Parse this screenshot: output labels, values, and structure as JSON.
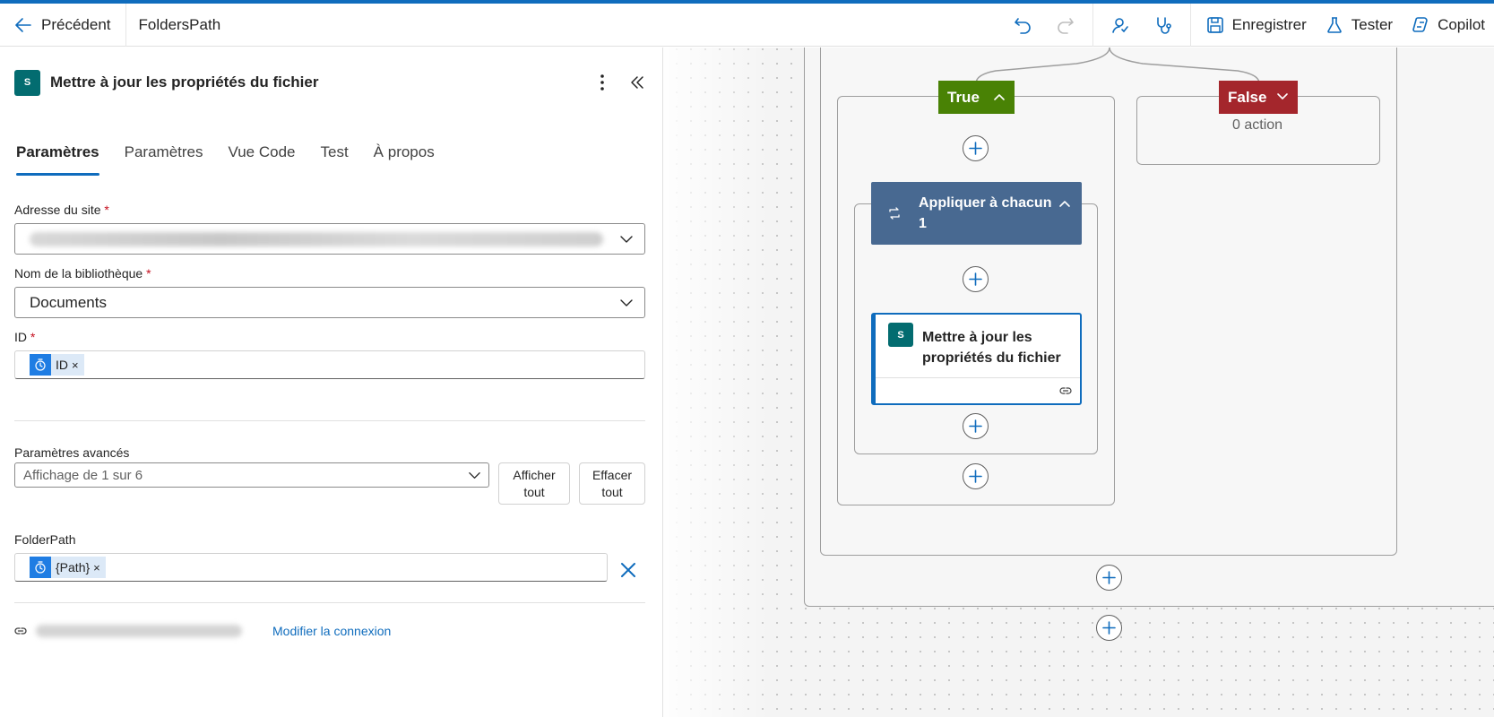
{
  "topbar": {
    "back_label": "Précédent",
    "flow_name": "FoldersPath",
    "icons": [
      "undo-icon",
      "redo-icon",
      "flow-checker-icon",
      "health-check-icon"
    ],
    "save_label": "Enregistrer",
    "test_label": "Tester",
    "copilot_label": "Copilot"
  },
  "panel": {
    "title": "Mettre à jour les propriétés du fichier",
    "tabs": [
      {
        "label": "Paramètres",
        "active": true
      },
      {
        "label": "Paramètres",
        "active": false
      },
      {
        "label": "Vue Code",
        "active": false
      },
      {
        "label": "Test",
        "active": false
      },
      {
        "label": "À propos",
        "active": false
      }
    ],
    "site_label": "Adresse du site",
    "library_label": "Nom de la bibliothèque",
    "library_value": "Documents",
    "id_label": "ID",
    "required_mark": "*",
    "id_token": "ID",
    "token_remove": "×",
    "advanced_label": "Paramètres avancés",
    "advanced_value": "Affichage de 1 sur 6",
    "show_all": "Afficher\ntout",
    "clear_all": "Effacer\ntout",
    "folderpath_label": "FolderPath",
    "folderpath_token": "{Path}",
    "modify_connection": "Modifier la connexion"
  },
  "canvas": {
    "true_label": "True",
    "false_label": "False",
    "false_empty": "0 action",
    "foreach_label": "Appliquer à chacun 1",
    "action_label": "Mettre à jour les propriétés du fichier",
    "sharepoint_letter": "S"
  },
  "colors": {
    "accent": "#0f6cbd",
    "true_branch": "#498205",
    "false_branch": "#a4262c",
    "foreach": "#486991",
    "sharepoint": "#036c70"
  }
}
